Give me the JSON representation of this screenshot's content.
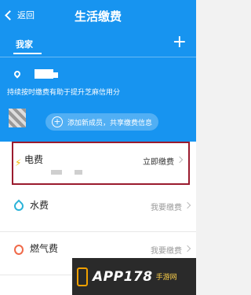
{
  "nav": {
    "back_label": "返回",
    "title": "生活缴费"
  },
  "header": {
    "tab_label": "我家",
    "add_symbol": "+"
  },
  "home": {
    "info_text": "持续按时缴费有助于提升芝麻信用分",
    "add_member_text": "添加新成员，共享缴费信息"
  },
  "bills": [
    {
      "label": "电费",
      "action": "立即缴费",
      "icon": "lightning-icon"
    },
    {
      "label": "水费",
      "action": "我要缴费",
      "icon": "water-drop-icon"
    },
    {
      "label": "燃气费",
      "action": "我要缴费",
      "icon": "flame-icon"
    }
  ],
  "watermark": {
    "text": "APP178",
    "sub": "手游网"
  },
  "colors": {
    "brand": "#1794f0",
    "highlight": "#9a1b2e"
  }
}
